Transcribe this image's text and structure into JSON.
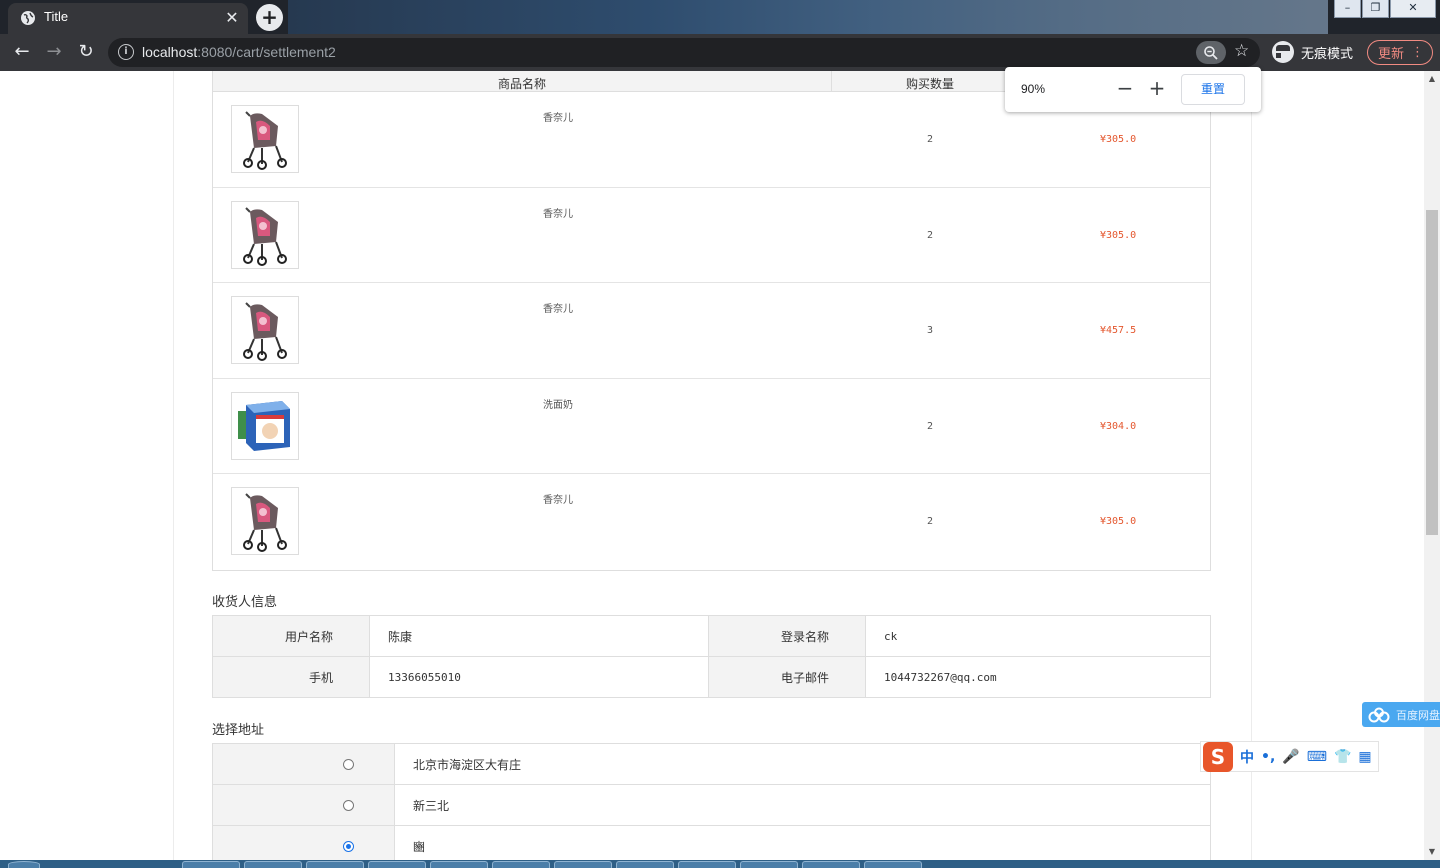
{
  "browser": {
    "tab_title": "Title",
    "tab_close": "✕",
    "new_tab": "+",
    "url_host": "localhost",
    "url_rest": ":8080/cart/settlement2",
    "incognito_label": "无痕模式",
    "update_label": "更新",
    "update_menu": "⋮",
    "window_buttons": [
      "–",
      "❐",
      "✕"
    ]
  },
  "zoom_popup": {
    "level": "90%",
    "minus": "−",
    "plus": "+",
    "reset": "重置"
  },
  "goods_table": {
    "headers": {
      "name": "商品名称",
      "quantity": "购买数量"
    },
    "rows": [
      {
        "image": "stroller",
        "name": "香奈儿",
        "quantity": "2",
        "price": "¥305.0"
      },
      {
        "image": "stroller",
        "name": "香奈儿",
        "quantity": "2",
        "price": "¥305.0"
      },
      {
        "image": "stroller",
        "name": "香奈儿",
        "quantity": "3",
        "price": "¥457.5"
      },
      {
        "image": "cream-box",
        "name": "洗面奶",
        "quantity": "2",
        "price": "¥304.0"
      },
      {
        "image": "stroller",
        "name": "香奈儿",
        "quantity": "2",
        "price": "¥305.0"
      }
    ]
  },
  "receiver": {
    "title": "收货人信息",
    "username_label": "用户名称",
    "username_value": "陈康",
    "login_label": "登录名称",
    "login_value": "ck",
    "phone_label": "手机",
    "phone_value": "13366055010",
    "email_label": "电子邮件",
    "email_value": "1044732267@qq.com"
  },
  "address": {
    "title": "选择地址",
    "options": [
      {
        "label": "北京市海淀区大有庄",
        "selected": false
      },
      {
        "label": "新三北",
        "selected": false
      },
      {
        "label": "豳",
        "selected": true
      }
    ]
  },
  "widgets": {
    "baidu_text": "百度网盘",
    "ime_items": [
      "中",
      "•,",
      "🎤",
      "⌨",
      "👕",
      "▦"
    ]
  },
  "colors": {
    "price": "#e4572e",
    "accent": "#1a73e8"
  }
}
